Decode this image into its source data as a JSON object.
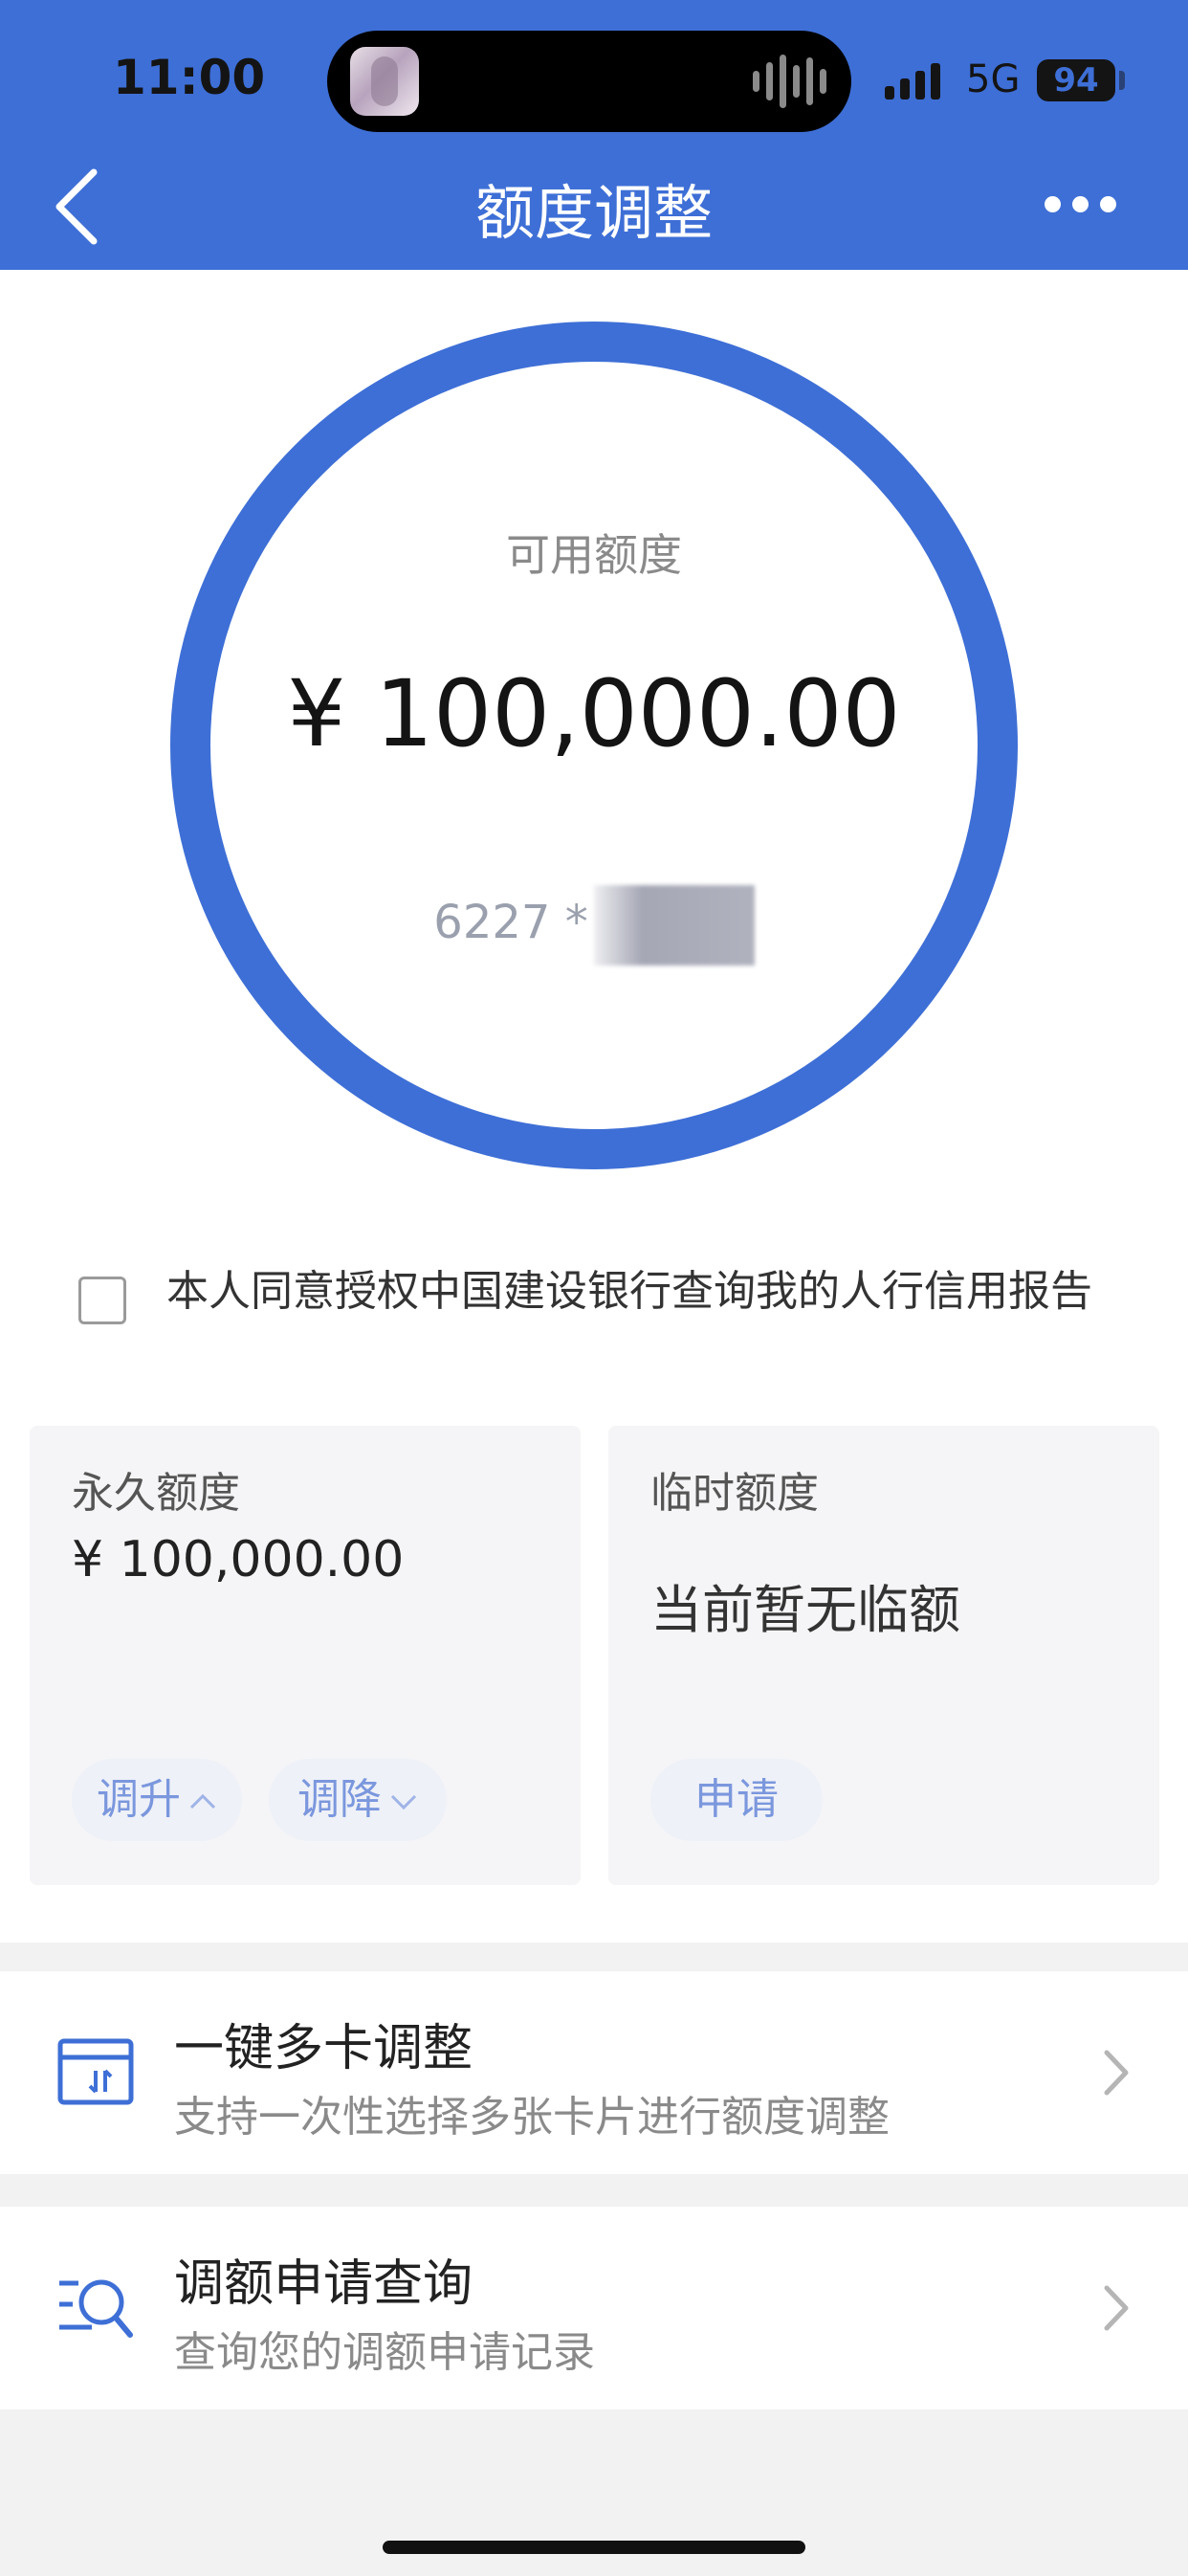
{
  "status_bar": {
    "time": "11:00",
    "network": "5G",
    "battery": "94"
  },
  "nav": {
    "title": "额度调整"
  },
  "available": {
    "label": "可用额度",
    "amount": "¥ 100,000.00",
    "card_prefix": "6227 *"
  },
  "consent": {
    "text": "本人同意授权中国建设银行查询我的人行信用报告",
    "checked": false
  },
  "permanent": {
    "title": "永久额度",
    "value": "¥  100,000.00",
    "increase_label": "调升",
    "decrease_label": "调降"
  },
  "temporary": {
    "title": "临时额度",
    "status": "当前暂无临额",
    "apply_label": "申请"
  },
  "rows": [
    {
      "title": "一键多卡调整",
      "subtitle": "支持一次性选择多张卡片进行额度调整",
      "icon": "multi-card-icon"
    },
    {
      "title": "调额申请查询",
      "subtitle": "查询您的调额申请记录",
      "icon": "search-list-icon"
    }
  ],
  "colors": {
    "brand": "#3e6fd6",
    "pill_text": "#7b97dd"
  }
}
